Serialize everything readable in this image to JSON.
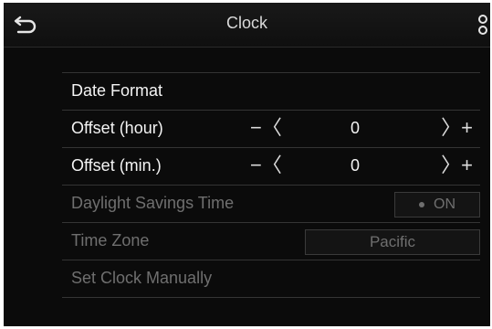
{
  "header": {
    "title": "Clock",
    "back_icon": "back-arrow-icon",
    "menu_icon": "menu-icon"
  },
  "rows": {
    "date_format": {
      "label": "Date Format"
    },
    "offset_hour": {
      "label": "Offset (hour)",
      "minus": "−〈",
      "value": "0",
      "plus": "〉+"
    },
    "offset_min": {
      "label": "Offset (min.)",
      "minus": "−〈",
      "value": "0",
      "plus": "〉+"
    },
    "dst": {
      "label": "Daylight Savings Time",
      "toggle": "ON"
    },
    "time_zone": {
      "label": "Time Zone",
      "value": "Pacific"
    },
    "set_clock": {
      "label": "Set Clock Manually"
    }
  },
  "colors": {
    "background": "#0b0b0b",
    "text": "#f4f4f4",
    "disabled_text": "#6f6f6f"
  }
}
